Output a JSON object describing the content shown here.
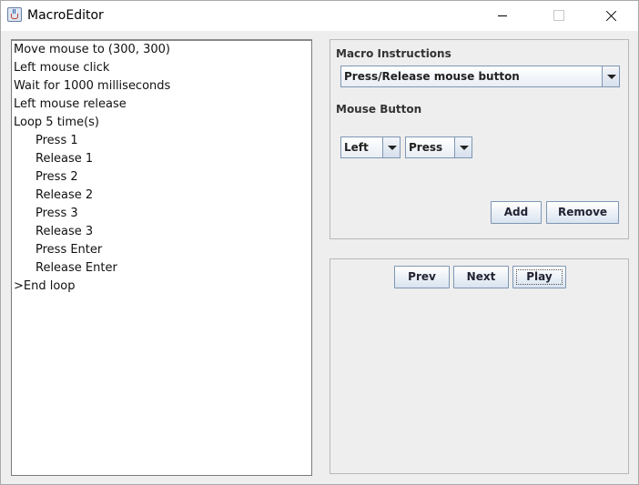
{
  "window": {
    "title": "MacroEditor"
  },
  "instructions": [
    {
      "text": "Move mouse to (300, 300)",
      "indent": 0
    },
    {
      "text": "Left mouse click",
      "indent": 0
    },
    {
      "text": "Wait for 1000 milliseconds",
      "indent": 0
    },
    {
      "text": "Left mouse release",
      "indent": 0
    },
    {
      "text": "Loop 5 time(s)",
      "indent": 0
    },
    {
      "text": "Press 1",
      "indent": 1
    },
    {
      "text": "Release 1",
      "indent": 1
    },
    {
      "text": "Press 2",
      "indent": 1
    },
    {
      "text": "Release 2",
      "indent": 1
    },
    {
      "text": "Press 3",
      "indent": 1
    },
    {
      "text": "Release 3",
      "indent": 1
    },
    {
      "text": "Press Enter",
      "indent": 1
    },
    {
      "text": "Release Enter",
      "indent": 1
    },
    {
      "text": ">End loop",
      "indent": 0
    }
  ],
  "editor": {
    "macro_instructions_label": "Macro Instructions",
    "macro_instruction_selected": "Press/Release mouse button",
    "mouse_button_label": "Mouse Button",
    "button_selected": "Left",
    "action_selected": "Press",
    "add_label": "Add",
    "remove_label": "Remove"
  },
  "playback": {
    "prev_label": "Prev",
    "next_label": "Next",
    "play_label": "Play"
  },
  "colors": {
    "button_border": "#7f96b3",
    "panel_background": "#eeeeee"
  }
}
